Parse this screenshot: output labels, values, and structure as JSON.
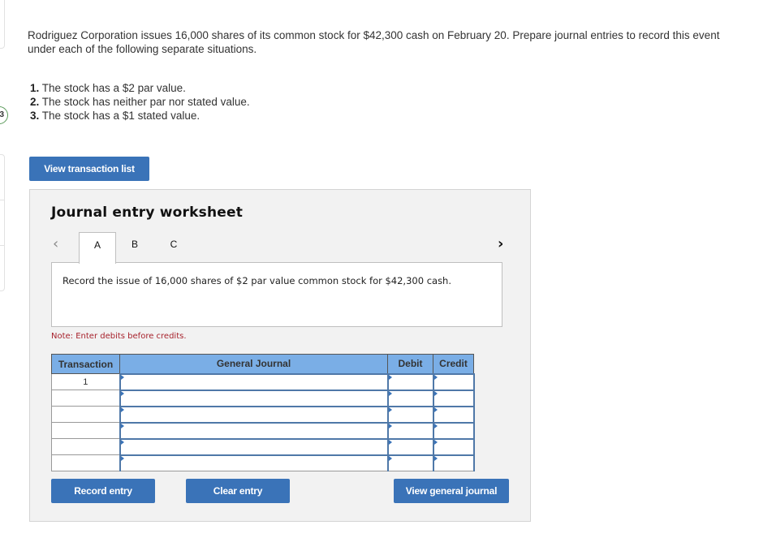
{
  "question": {
    "text": "Rodriguez Corporation issues 16,000 shares of its common stock for $42,300 cash on February 20. Prepare journal entries to record this event under each of the following separate situations.",
    "situations": [
      {
        "num": "1.",
        "text": " The stock has a $2 par value."
      },
      {
        "num": "2.",
        "text": " The stock has neither par nor stated value."
      },
      {
        "num": "3.",
        "text": " The stock has a $1 stated value."
      }
    ]
  },
  "side": {
    "step_label": "3"
  },
  "buttons": {
    "view_transaction_list": "View transaction list",
    "record_entry": "Record entry",
    "clear_entry": "Clear entry",
    "view_general_journal": "View general journal"
  },
  "worksheet": {
    "title": "Journal entry worksheet",
    "nav_prev": "‹",
    "nav_next": "›",
    "tabs": [
      {
        "label": "A",
        "active": true
      },
      {
        "label": "B",
        "active": false
      },
      {
        "label": "C",
        "active": false
      }
    ],
    "prompt": "Record the issue of 16,000 shares of $2 par value common stock for $42,300 cash.",
    "note": "Note: Enter debits before credits.",
    "table": {
      "headers": {
        "transaction": "Transaction",
        "general_journal": "General Journal",
        "debit": "Debit",
        "credit": "Credit"
      },
      "rows": [
        {
          "transaction": "1",
          "account": "",
          "debit": "",
          "credit": ""
        },
        {
          "transaction": "",
          "account": "",
          "debit": "",
          "credit": ""
        },
        {
          "transaction": "",
          "account": "",
          "debit": "",
          "credit": ""
        },
        {
          "transaction": "",
          "account": "",
          "debit": "",
          "credit": ""
        },
        {
          "transaction": "",
          "account": "",
          "debit": "",
          "credit": ""
        },
        {
          "transaction": "",
          "account": "",
          "debit": "",
          "credit": ""
        }
      ]
    }
  },
  "colors": {
    "button_blue": "#3a73b8",
    "table_header": "#7aaee6",
    "note_red": "#a7222c",
    "worksheet_bg": "#f2f2f2"
  }
}
